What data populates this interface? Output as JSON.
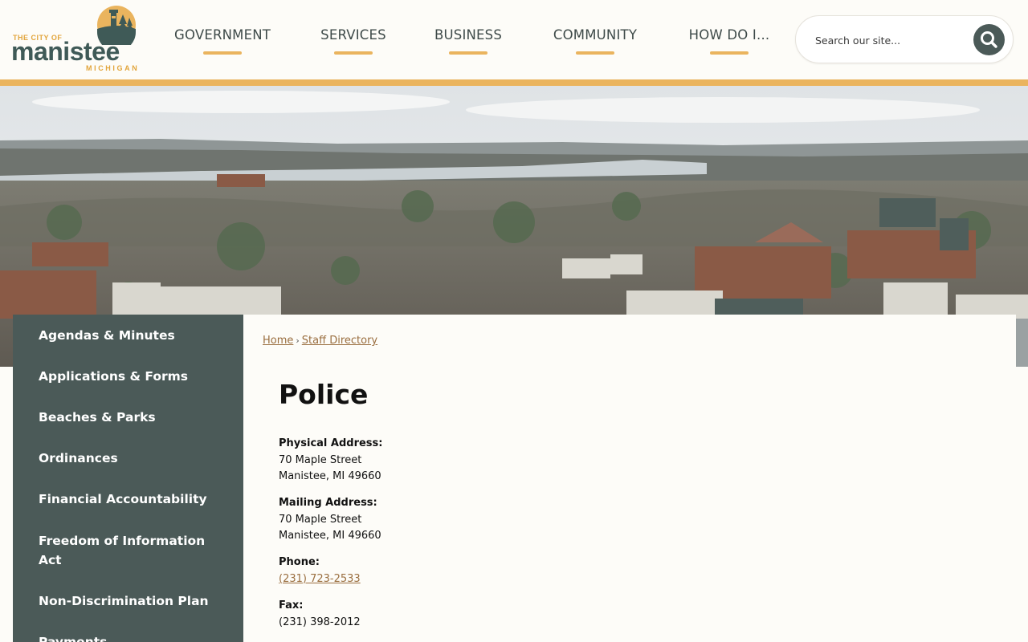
{
  "logo": {
    "prefix": "THE CITY OF",
    "name": "manistee",
    "state": "MICHIGAN"
  },
  "nav": {
    "items": [
      {
        "label": "GOVERNMENT"
      },
      {
        "label": "SERVICES"
      },
      {
        "label": "BUSINESS"
      },
      {
        "label": "COMMUNITY"
      },
      {
        "label": "HOW DO I..."
      }
    ]
  },
  "search": {
    "placeholder": "Search our site...",
    "icon": "search-icon"
  },
  "sidebar": {
    "items": [
      {
        "label": "Agendas & Minutes"
      },
      {
        "label": "Applications & Forms"
      },
      {
        "label": "Beaches & Parks"
      },
      {
        "label": "Ordinances"
      },
      {
        "label": "Financial Accountability"
      },
      {
        "label": "Freedom of Information Act"
      },
      {
        "label": "Non-Discrimination Plan"
      },
      {
        "label": "Payments"
      }
    ]
  },
  "breadcrumb": {
    "home": "Home",
    "separator": "›",
    "current": "Staff Directory"
  },
  "page": {
    "title": "Police",
    "physical_label": "Physical Address:",
    "physical_line1": "70 Maple Street",
    "physical_line2": "Manistee, MI 49660",
    "mailing_label": "Mailing Address:",
    "mailing_line1": "70 Maple Street",
    "mailing_line2": "Manistee, MI 49660",
    "phone_label": "Phone:",
    "phone": "(231) 723-2533",
    "fax_label": "Fax:",
    "fax": "(231) 398-2012"
  },
  "colors": {
    "accent": "#eab45e",
    "sidebar": "#4b5a58",
    "link": "#9a6e3f",
    "background": "#fdfcf8"
  }
}
